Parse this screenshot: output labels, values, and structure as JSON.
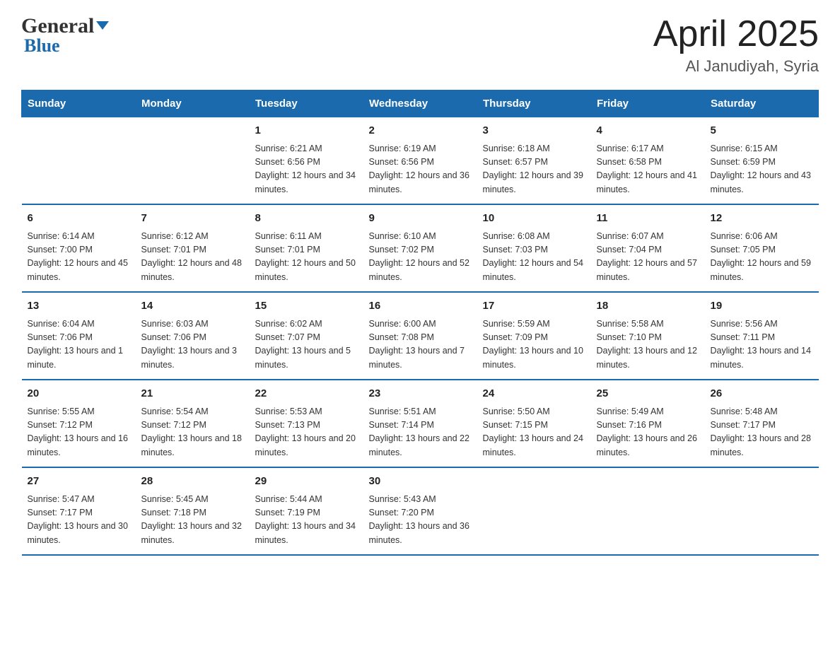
{
  "header": {
    "logo_general": "General",
    "logo_blue": "Blue",
    "month_year": "April 2025",
    "location": "Al Janudiyah, Syria"
  },
  "days_of_week": [
    "Sunday",
    "Monday",
    "Tuesday",
    "Wednesday",
    "Thursday",
    "Friday",
    "Saturday"
  ],
  "weeks": [
    [
      {
        "day": "",
        "sunrise": "",
        "sunset": "",
        "daylight": ""
      },
      {
        "day": "",
        "sunrise": "",
        "sunset": "",
        "daylight": ""
      },
      {
        "day": "1",
        "sunrise": "Sunrise: 6:21 AM",
        "sunset": "Sunset: 6:56 PM",
        "daylight": "Daylight: 12 hours and 34 minutes."
      },
      {
        "day": "2",
        "sunrise": "Sunrise: 6:19 AM",
        "sunset": "Sunset: 6:56 PM",
        "daylight": "Daylight: 12 hours and 36 minutes."
      },
      {
        "day": "3",
        "sunrise": "Sunrise: 6:18 AM",
        "sunset": "Sunset: 6:57 PM",
        "daylight": "Daylight: 12 hours and 39 minutes."
      },
      {
        "day": "4",
        "sunrise": "Sunrise: 6:17 AM",
        "sunset": "Sunset: 6:58 PM",
        "daylight": "Daylight: 12 hours and 41 minutes."
      },
      {
        "day": "5",
        "sunrise": "Sunrise: 6:15 AM",
        "sunset": "Sunset: 6:59 PM",
        "daylight": "Daylight: 12 hours and 43 minutes."
      }
    ],
    [
      {
        "day": "6",
        "sunrise": "Sunrise: 6:14 AM",
        "sunset": "Sunset: 7:00 PM",
        "daylight": "Daylight: 12 hours and 45 minutes."
      },
      {
        "day": "7",
        "sunrise": "Sunrise: 6:12 AM",
        "sunset": "Sunset: 7:01 PM",
        "daylight": "Daylight: 12 hours and 48 minutes."
      },
      {
        "day": "8",
        "sunrise": "Sunrise: 6:11 AM",
        "sunset": "Sunset: 7:01 PM",
        "daylight": "Daylight: 12 hours and 50 minutes."
      },
      {
        "day": "9",
        "sunrise": "Sunrise: 6:10 AM",
        "sunset": "Sunset: 7:02 PM",
        "daylight": "Daylight: 12 hours and 52 minutes."
      },
      {
        "day": "10",
        "sunrise": "Sunrise: 6:08 AM",
        "sunset": "Sunset: 7:03 PM",
        "daylight": "Daylight: 12 hours and 54 minutes."
      },
      {
        "day": "11",
        "sunrise": "Sunrise: 6:07 AM",
        "sunset": "Sunset: 7:04 PM",
        "daylight": "Daylight: 12 hours and 57 minutes."
      },
      {
        "day": "12",
        "sunrise": "Sunrise: 6:06 AM",
        "sunset": "Sunset: 7:05 PM",
        "daylight": "Daylight: 12 hours and 59 minutes."
      }
    ],
    [
      {
        "day": "13",
        "sunrise": "Sunrise: 6:04 AM",
        "sunset": "Sunset: 7:06 PM",
        "daylight": "Daylight: 13 hours and 1 minute."
      },
      {
        "day": "14",
        "sunrise": "Sunrise: 6:03 AM",
        "sunset": "Sunset: 7:06 PM",
        "daylight": "Daylight: 13 hours and 3 minutes."
      },
      {
        "day": "15",
        "sunrise": "Sunrise: 6:02 AM",
        "sunset": "Sunset: 7:07 PM",
        "daylight": "Daylight: 13 hours and 5 minutes."
      },
      {
        "day": "16",
        "sunrise": "Sunrise: 6:00 AM",
        "sunset": "Sunset: 7:08 PM",
        "daylight": "Daylight: 13 hours and 7 minutes."
      },
      {
        "day": "17",
        "sunrise": "Sunrise: 5:59 AM",
        "sunset": "Sunset: 7:09 PM",
        "daylight": "Daylight: 13 hours and 10 minutes."
      },
      {
        "day": "18",
        "sunrise": "Sunrise: 5:58 AM",
        "sunset": "Sunset: 7:10 PM",
        "daylight": "Daylight: 13 hours and 12 minutes."
      },
      {
        "day": "19",
        "sunrise": "Sunrise: 5:56 AM",
        "sunset": "Sunset: 7:11 PM",
        "daylight": "Daylight: 13 hours and 14 minutes."
      }
    ],
    [
      {
        "day": "20",
        "sunrise": "Sunrise: 5:55 AM",
        "sunset": "Sunset: 7:12 PM",
        "daylight": "Daylight: 13 hours and 16 minutes."
      },
      {
        "day": "21",
        "sunrise": "Sunrise: 5:54 AM",
        "sunset": "Sunset: 7:12 PM",
        "daylight": "Daylight: 13 hours and 18 minutes."
      },
      {
        "day": "22",
        "sunrise": "Sunrise: 5:53 AM",
        "sunset": "Sunset: 7:13 PM",
        "daylight": "Daylight: 13 hours and 20 minutes."
      },
      {
        "day": "23",
        "sunrise": "Sunrise: 5:51 AM",
        "sunset": "Sunset: 7:14 PM",
        "daylight": "Daylight: 13 hours and 22 minutes."
      },
      {
        "day": "24",
        "sunrise": "Sunrise: 5:50 AM",
        "sunset": "Sunset: 7:15 PM",
        "daylight": "Daylight: 13 hours and 24 minutes."
      },
      {
        "day": "25",
        "sunrise": "Sunrise: 5:49 AM",
        "sunset": "Sunset: 7:16 PM",
        "daylight": "Daylight: 13 hours and 26 minutes."
      },
      {
        "day": "26",
        "sunrise": "Sunrise: 5:48 AM",
        "sunset": "Sunset: 7:17 PM",
        "daylight": "Daylight: 13 hours and 28 minutes."
      }
    ],
    [
      {
        "day": "27",
        "sunrise": "Sunrise: 5:47 AM",
        "sunset": "Sunset: 7:17 PM",
        "daylight": "Daylight: 13 hours and 30 minutes."
      },
      {
        "day": "28",
        "sunrise": "Sunrise: 5:45 AM",
        "sunset": "Sunset: 7:18 PM",
        "daylight": "Daylight: 13 hours and 32 minutes."
      },
      {
        "day": "29",
        "sunrise": "Sunrise: 5:44 AM",
        "sunset": "Sunset: 7:19 PM",
        "daylight": "Daylight: 13 hours and 34 minutes."
      },
      {
        "day": "30",
        "sunrise": "Sunrise: 5:43 AM",
        "sunset": "Sunset: 7:20 PM",
        "daylight": "Daylight: 13 hours and 36 minutes."
      },
      {
        "day": "",
        "sunrise": "",
        "sunset": "",
        "daylight": ""
      },
      {
        "day": "",
        "sunrise": "",
        "sunset": "",
        "daylight": ""
      },
      {
        "day": "",
        "sunrise": "",
        "sunset": "",
        "daylight": ""
      }
    ]
  ]
}
